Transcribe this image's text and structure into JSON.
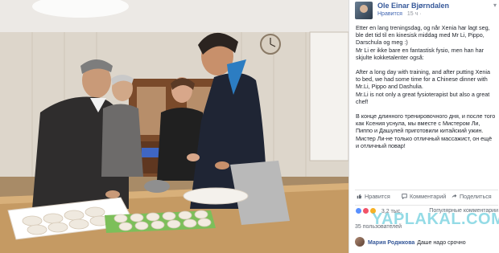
{
  "post": {
    "author": "Ole Einar Bjørndalen",
    "like_label": "Нравится",
    "time": "15 ч",
    "paragraphs": [
      "Etter en lang treningsdag, og når Xenia har lagt seg, ble det tid til en kinesisk middag med Mr Li, Pippo, Darschula og meg :)\nMr Li er ikke bare en fantastisk fysio, men han har skjulte kokketalenter også:",
      "After a long day with training, and after putting Xenia to bed, we had some time for a Chinese dinner with Mr.Li, Pippo and Dashulia.\nMr.Li is not only a great fysioterapist but also a great chef!",
      "В конце длинного тренировочного дня, и после того как Ксения уснула, мы вместе с Мистером Ли, Пиппо и Дашулей приготовили китайский ужин.\nМистер Ли-не только отличный массажист, он ещё и отличный повар!"
    ]
  },
  "actions": {
    "like": "Нравится",
    "comment": "Комментарий",
    "share": "Поделиться"
  },
  "reactions": {
    "count": "3,2 тыс.",
    "popular_comments": "Популярные комментарии"
  },
  "comments_info": "35 пользователей",
  "first_comment": {
    "name": "Мария Роджкова",
    "text": "Даше надо срочно"
  },
  "watermark": "YAPLAKAL.COM",
  "colors": {
    "link": "#365899",
    "accent": "#4267b2",
    "muted": "#90949c",
    "like_emoji": "#5890ff",
    "love_emoji": "#f25268",
    "haha_emoji": "#f7b125"
  },
  "icons": [
    "chevron-down-icon",
    "thumbs-up-icon",
    "comment-icon",
    "share-icon"
  ]
}
